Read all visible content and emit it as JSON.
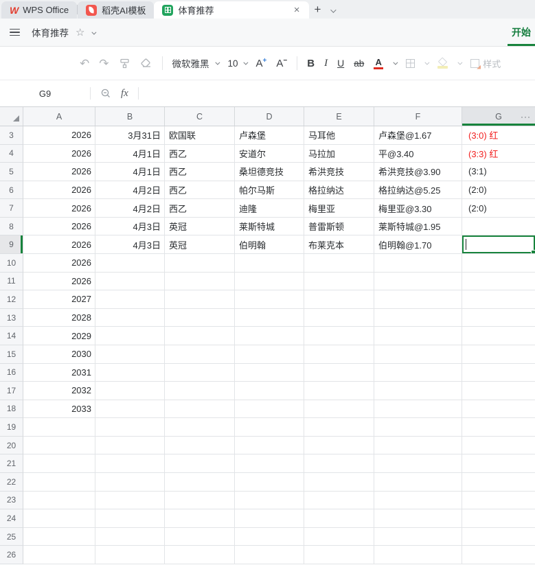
{
  "colors": {
    "accent_green": "#17833c",
    "red_text": "#f21f1f",
    "tab_icon_green": "#21a45d",
    "tab_icon_red": "#f2564e",
    "wps_red": "#e23e30"
  },
  "tabbar": {
    "tabs": [
      {
        "label": "WPS Office",
        "icon": "wps-logo",
        "active": false
      },
      {
        "label": "稻壳AI模板",
        "icon": "docer-leaf-icon",
        "active": false
      },
      {
        "label": "体育推荐",
        "icon": "spreadsheet-icon",
        "active": true
      }
    ],
    "wps_logo_letter": "W",
    "close_glyph": "×",
    "add_glyph": "+"
  },
  "titlebar": {
    "title": "体育推荐",
    "star_glyph": "☆",
    "ribbon_tab": "开始"
  },
  "toolbar": {
    "undo_glyph": "↶",
    "redo_glyph": "↷",
    "font_name": "微软雅黑",
    "font_size": "10",
    "increase_letter": "A",
    "increase_sign": "+",
    "decrease_letter": "A",
    "decrease_sign": "−",
    "bold": "B",
    "italic": "I",
    "underline": "U",
    "strikethrough": "ab",
    "font_color_letter": "A",
    "styles_label": "样式"
  },
  "formula_bar": {
    "cell_ref": "G9",
    "fx_glyph": "fx"
  },
  "sheet": {
    "columns": [
      "A",
      "B",
      "C",
      "D",
      "E",
      "F",
      "G"
    ],
    "more_glyph": "···",
    "selected_cell": "G9",
    "selected_row": 9,
    "selected_col": "G",
    "rows": [
      {
        "n": 3,
        "cells": [
          "2026",
          "3月31日",
          "欧国联",
          "卢森堡",
          "马耳他",
          "卢森堡@1.67",
          "(3:0) 红"
        ],
        "g_red": true
      },
      {
        "n": 4,
        "cells": [
          "2026",
          "4月1日",
          "西乙",
          "安道尔",
          "马拉加",
          "平@3.40",
          "(3:3) 红"
        ],
        "g_red": true
      },
      {
        "n": 5,
        "cells": [
          "2026",
          "4月1日",
          "西乙",
          "桑坦德竞技",
          "希洪竞技",
          "希洪竞技@3.90",
          "(3:1)"
        ],
        "g_red": false
      },
      {
        "n": 6,
        "cells": [
          "2026",
          "4月2日",
          "西乙",
          "帕尔马斯",
          "格拉纳达",
          "格拉纳达@5.25",
          "(2:0)"
        ],
        "g_red": false
      },
      {
        "n": 7,
        "cells": [
          "2026",
          "4月2日",
          "西乙",
          "迪隆",
          "梅里亚",
          "梅里亚@3.30",
          "(2:0)"
        ],
        "g_red": false
      },
      {
        "n": 8,
        "cells": [
          "2026",
          "4月3日",
          "英冠",
          "莱斯特城",
          "普雷斯顿",
          "莱斯特城@1.95",
          ""
        ],
        "g_red": false
      },
      {
        "n": 9,
        "cells": [
          "2026",
          "4月3日",
          "英冠",
          "伯明翰",
          "布莱克本",
          "伯明翰@1.70",
          ""
        ],
        "g_red": false
      },
      {
        "n": 10,
        "cells": [
          "2026",
          "",
          "",
          "",
          "",
          "",
          ""
        ],
        "g_red": false
      },
      {
        "n": 11,
        "cells": [
          "2026",
          "",
          "",
          "",
          "",
          "",
          ""
        ],
        "g_red": false
      },
      {
        "n": 12,
        "cells": [
          "2027",
          "",
          "",
          "",
          "",
          "",
          ""
        ],
        "g_red": false
      },
      {
        "n": 13,
        "cells": [
          "2028",
          "",
          "",
          "",
          "",
          "",
          ""
        ],
        "g_red": false
      },
      {
        "n": 14,
        "cells": [
          "2029",
          "",
          "",
          "",
          "",
          "",
          ""
        ],
        "g_red": false
      },
      {
        "n": 15,
        "cells": [
          "2030",
          "",
          "",
          "",
          "",
          "",
          ""
        ],
        "g_red": false
      },
      {
        "n": 16,
        "cells": [
          "2031",
          "",
          "",
          "",
          "",
          "",
          ""
        ],
        "g_red": false
      },
      {
        "n": 17,
        "cells": [
          "2032",
          "",
          "",
          "",
          "",
          "",
          ""
        ],
        "g_red": false
      },
      {
        "n": 18,
        "cells": [
          "2033",
          "",
          "",
          "",
          "",
          "",
          ""
        ],
        "g_red": false
      },
      {
        "n": 19,
        "cells": [
          "",
          "",
          "",
          "",
          "",
          "",
          ""
        ],
        "g_red": false
      },
      {
        "n": 20,
        "cells": [
          "",
          "",
          "",
          "",
          "",
          "",
          ""
        ],
        "g_red": false
      },
      {
        "n": 21,
        "cells": [
          "",
          "",
          "",
          "",
          "",
          "",
          ""
        ],
        "g_red": false
      },
      {
        "n": 22,
        "cells": [
          "",
          "",
          "",
          "",
          "",
          "",
          ""
        ],
        "g_red": false
      },
      {
        "n": 23,
        "cells": [
          "",
          "",
          "",
          "",
          "",
          "",
          ""
        ],
        "g_red": false
      },
      {
        "n": 24,
        "cells": [
          "",
          "",
          "",
          "",
          "",
          "",
          ""
        ],
        "g_red": false
      },
      {
        "n": 25,
        "cells": [
          "",
          "",
          "",
          "",
          "",
          "",
          ""
        ],
        "g_red": false
      },
      {
        "n": 26,
        "cells": [
          "",
          "",
          "",
          "",
          "",
          "",
          ""
        ],
        "g_red": false
      }
    ]
  }
}
